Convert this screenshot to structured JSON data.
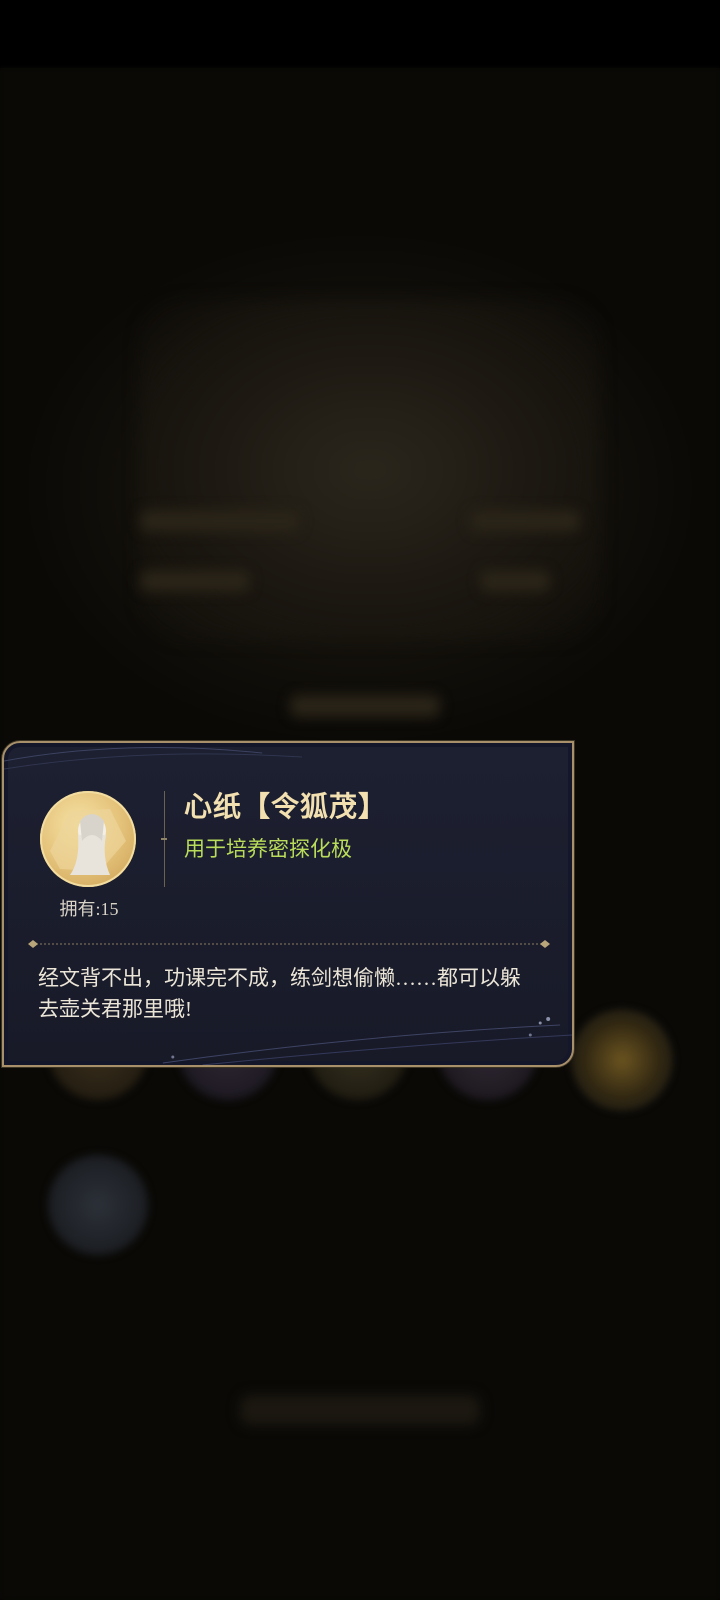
{
  "item": {
    "name": "心纸【令狐茂】",
    "use": "用于培养密探化极",
    "owned": "拥有:15",
    "description": "经文背不出，功课完不成，练剑想偷懒……都可以躲去壶关君那里哦!"
  },
  "colors": {
    "card_border": "#a8916a",
    "card_bg": "#1d2031",
    "name_color": "#f3e0b0",
    "use_color": "#b9dd5a",
    "text_color": "#ece6d8"
  }
}
